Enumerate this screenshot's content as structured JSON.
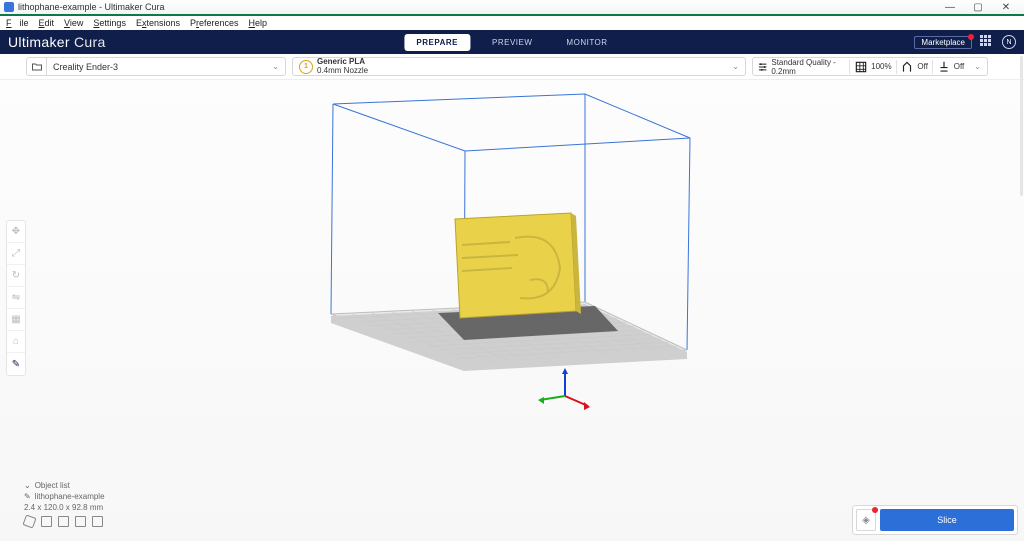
{
  "window": {
    "title": "lithophane-example - Ultimaker Cura",
    "min": "—",
    "max": "▢",
    "close": "✕"
  },
  "menu": {
    "file": "File",
    "edit": "Edit",
    "view": "View",
    "settings": "Settings",
    "extensions": "Extensions",
    "preferences": "Preferences",
    "help": "Help"
  },
  "brand": {
    "a": "Ultimaker",
    "b": " Cura"
  },
  "tabs": {
    "prepare": "PREPARE",
    "preview": "PREVIEW",
    "monitor": "MONITOR"
  },
  "header_right": {
    "marketplace": "Marketplace",
    "avatar": "N"
  },
  "printer": {
    "name": "Creality Ender-3"
  },
  "material": {
    "line1": "Generic PLA",
    "line2": "0.4mm Nozzle",
    "badge": "1"
  },
  "print_settings": {
    "quality": "Standard Quality - 0.2mm",
    "infill": "100%",
    "support": "Off",
    "adhesion": "Off"
  },
  "objectlist": {
    "header": "Object list",
    "item": "lithophane-example",
    "dims": "2.4 x 120.0 x 92.8 mm"
  },
  "slice": {
    "button": "Slice"
  }
}
